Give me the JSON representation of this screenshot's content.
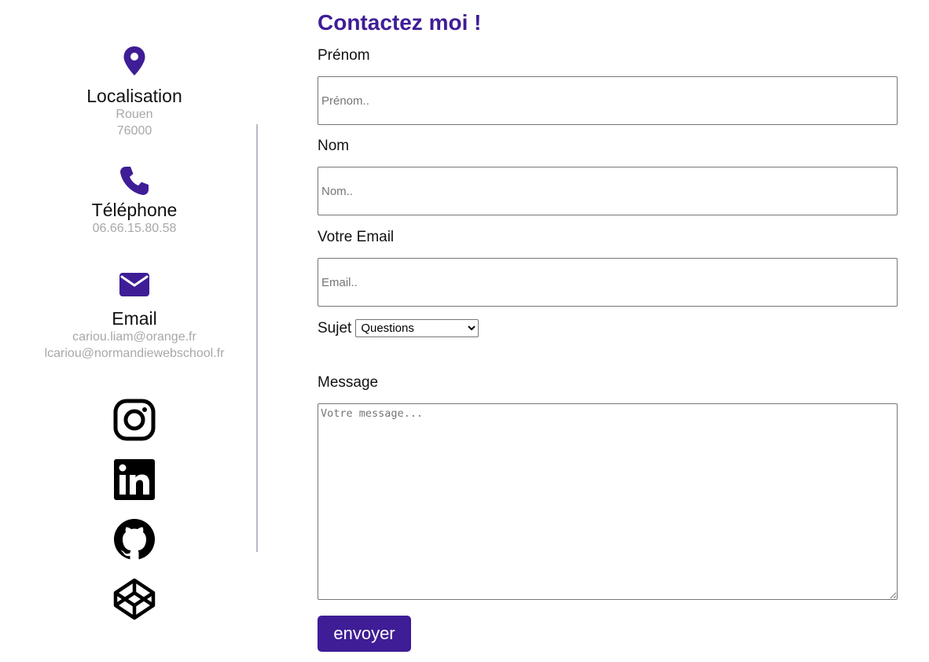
{
  "colors": {
    "accent": "#3f1d96",
    "muted_text": "#a8a8a8",
    "divider": "#b9b9c6"
  },
  "contact_info": {
    "location": {
      "icon": "map-pin-icon",
      "title": "Localisation",
      "city": "Rouen",
      "postcode": "76000"
    },
    "phone": {
      "icon": "phone-icon",
      "title": "Téléphone",
      "number": "06.66.15.80.58"
    },
    "email": {
      "icon": "envelope-icon",
      "title": "Email",
      "addresses": [
        "cariou.liam@orange.fr",
        "lcariou@normandiewebschool.fr"
      ]
    }
  },
  "socials": [
    {
      "icon": "instagram-icon"
    },
    {
      "icon": "linkedin-icon"
    },
    {
      "icon": "github-icon"
    },
    {
      "icon": "codepen-icon"
    }
  ],
  "form": {
    "title": "Contactez moi !",
    "first_name": {
      "label": "Prénom",
      "placeholder": "Prénom.."
    },
    "last_name": {
      "label": "Nom",
      "placeholder": "Nom.."
    },
    "email": {
      "label": "Votre Email",
      "placeholder": "Email.."
    },
    "subject": {
      "label": "Sujet",
      "selected": "Questions"
    },
    "message": {
      "label": "Message",
      "placeholder": "Votre message..."
    },
    "submit_label": "envoyer"
  }
}
